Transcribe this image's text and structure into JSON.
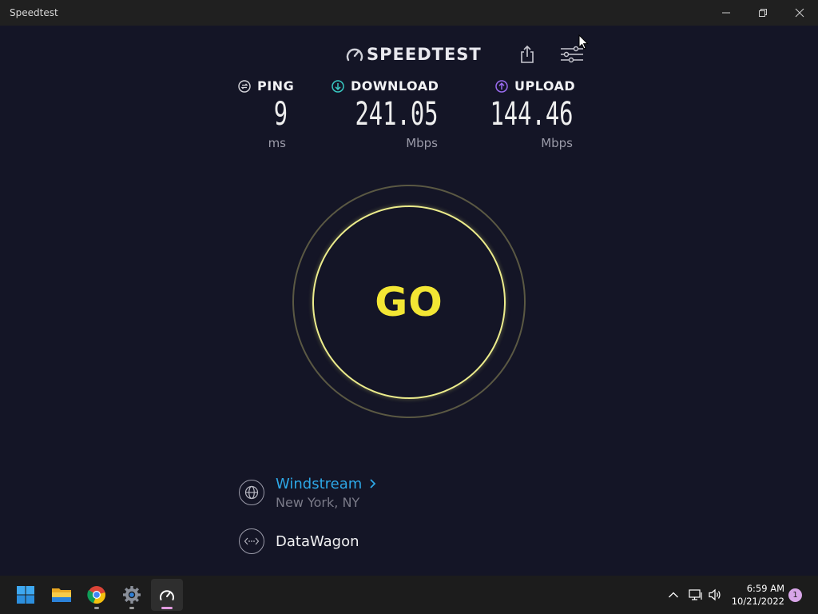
{
  "window": {
    "title": "Speedtest"
  },
  "brand": {
    "name": "SPEEDTEST"
  },
  "metrics": {
    "ping": {
      "label": "PING",
      "value": "9",
      "unit": "ms",
      "icon": "ping-icon"
    },
    "download": {
      "label": "DOWNLOAD",
      "value": "241.05",
      "unit": "Mbps",
      "icon": "download-arrow-icon"
    },
    "upload": {
      "label": "UPLOAD",
      "value": "144.46",
      "unit": "Mbps",
      "icon": "upload-arrow-icon"
    }
  },
  "go_button": {
    "label": "GO"
  },
  "server": {
    "isp": "Windstream",
    "location": "New York, NY",
    "host": "DataWagon"
  },
  "taskbar": {
    "apps": [
      "start-icon",
      "file-explorer-icon",
      "chrome-icon",
      "settings-icon",
      "speedtest-icon"
    ],
    "time": "6:59 AM",
    "date": "10/21/2022",
    "notifications": "1"
  },
  "colors": {
    "background": "#141526",
    "go_text": "#f3e634",
    "go_ring": "#ecec8c",
    "download_accent": "#38c9c2",
    "upload_accent": "#9b6cf0",
    "isp_link": "#2da7e6"
  }
}
